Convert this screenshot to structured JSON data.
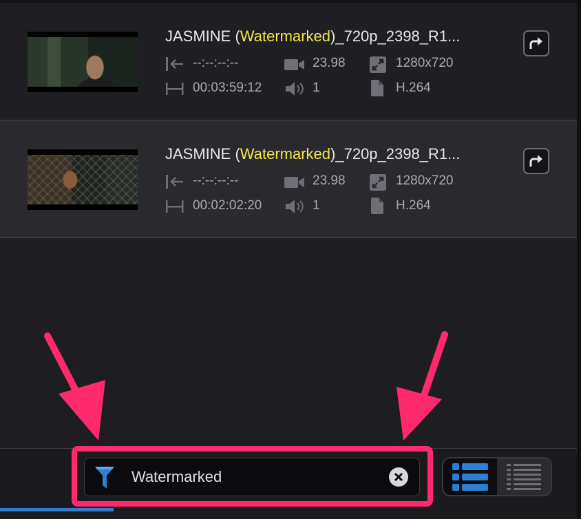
{
  "clips": [
    {
      "title_prefix": "JASMINE (",
      "title_highlight": "Watermarked",
      "title_suffix": ")_720p_2398_R1...",
      "in_point": "--:--:--:--",
      "duration": "00:03:59:12",
      "fps": "23.98",
      "audio_channels": "1",
      "resolution": "1280x720",
      "codec": "H.264"
    },
    {
      "title_prefix": "JASMINE (",
      "title_highlight": "Watermarked",
      "title_suffix": ")_720p_2398_R1...",
      "in_point": "--:--:--:--",
      "duration": "00:02:02:20",
      "fps": "23.98",
      "audio_channels": "1",
      "resolution": "1280x720",
      "codec": "H.264"
    }
  ],
  "filter": {
    "value": "Watermarked"
  },
  "colors": {
    "highlight_text": "#f2e84a",
    "accent_blue": "#2c7fd1",
    "annotation_pink": "#ff2a6d"
  },
  "icons": [
    "in-point-icon",
    "duration-icon",
    "video-camera-icon",
    "volume-icon",
    "resolution-icon",
    "file-icon",
    "share-icon",
    "filter-icon",
    "clear-icon",
    "list-view-icon",
    "compact-list-view-icon"
  ]
}
